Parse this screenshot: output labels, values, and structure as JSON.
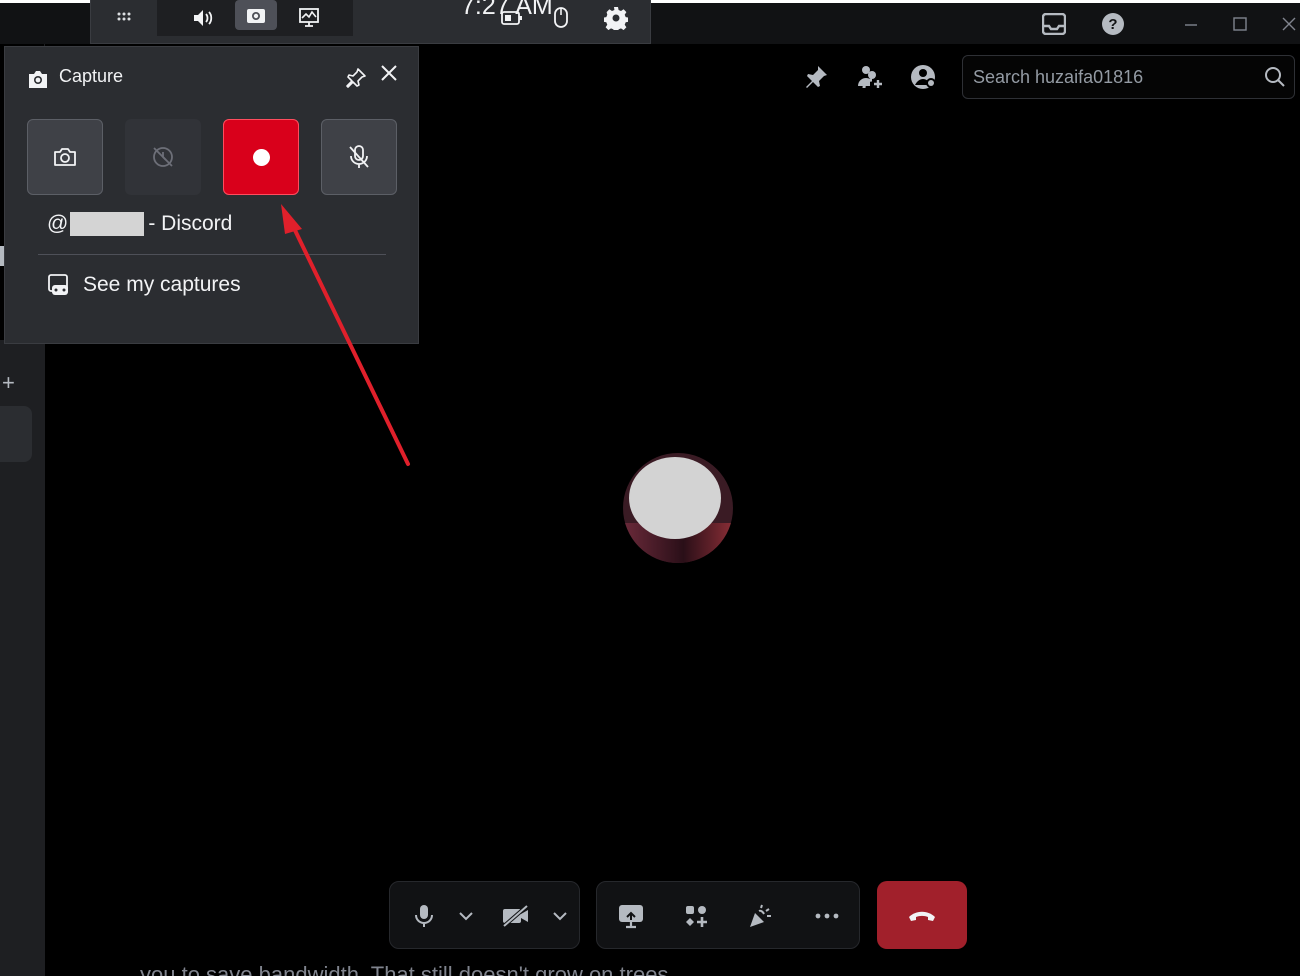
{
  "gamebar": {
    "time": "7:27 AM"
  },
  "capture": {
    "title": "Capture",
    "target_prefix": "@",
    "target_suffix": "- Discord",
    "see_captures": "See my captures"
  },
  "search": {
    "placeholder": "Search huzaifa01816"
  },
  "bottom": {
    "text": "you to save bandwidth. That still doesn't grow on trees."
  },
  "colors": {
    "record": "#d9001b",
    "hangup": "#a1202b",
    "arrow": "#e0202b"
  }
}
